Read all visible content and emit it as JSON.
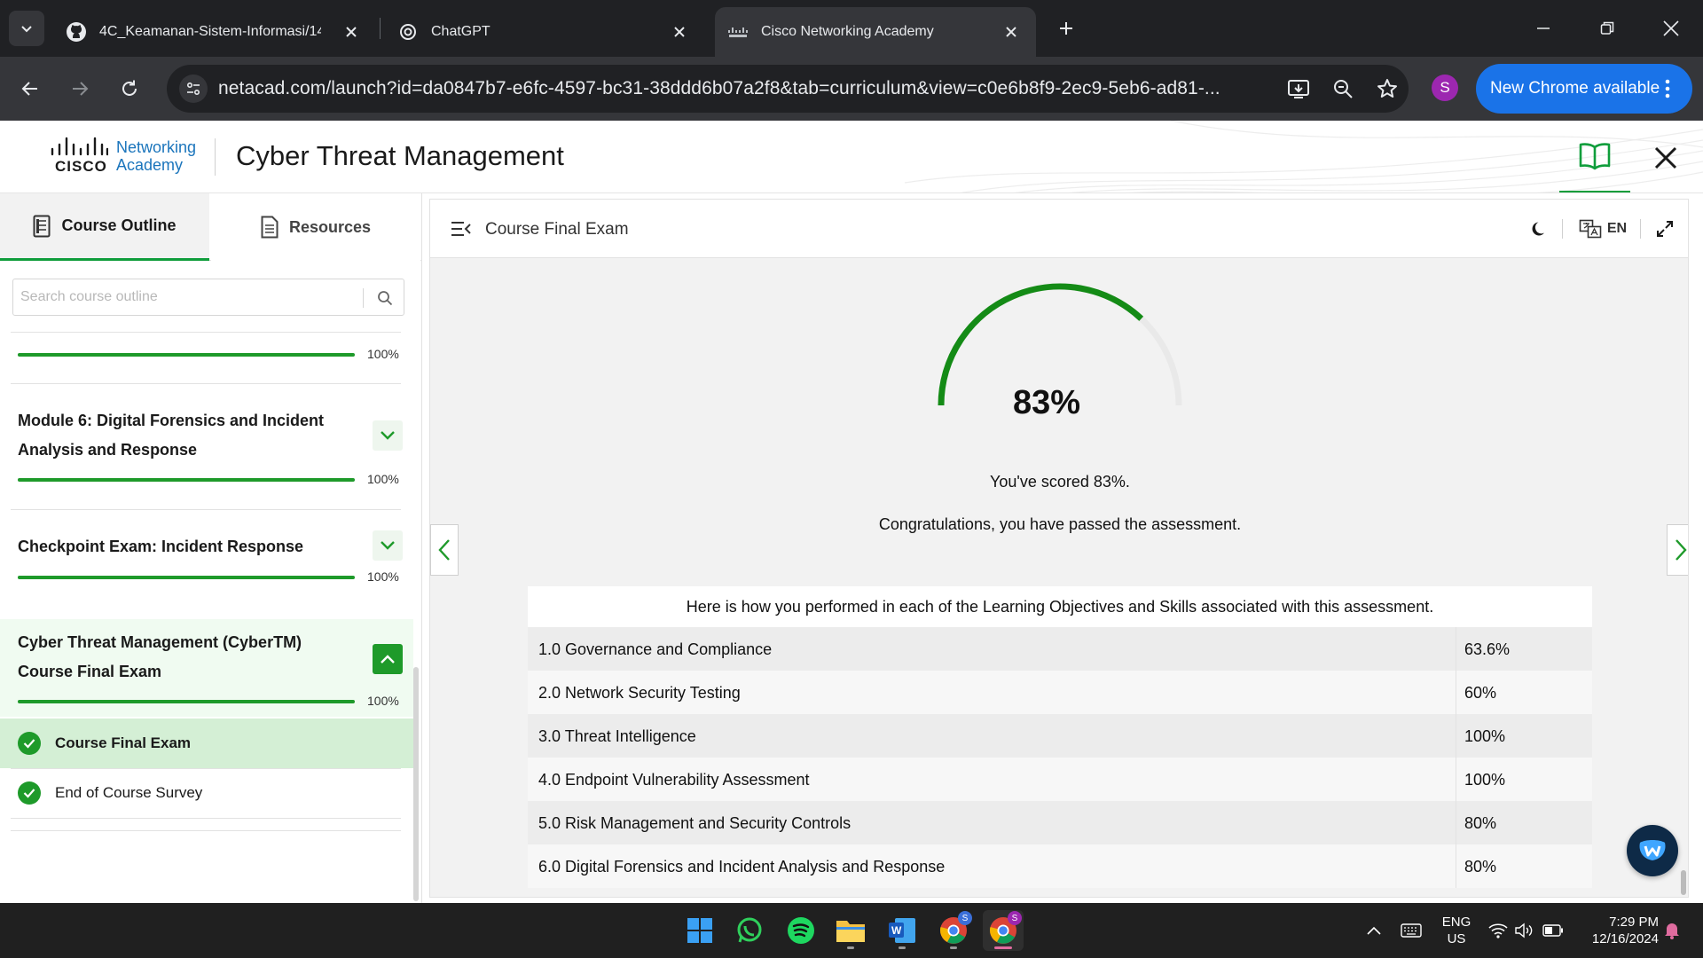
{
  "browser": {
    "tabs": [
      {
        "title": "4C_Keamanan-Sistem-Informasi/14_S...",
        "icon": "github-icon"
      },
      {
        "title": "ChatGPT",
        "icon": "openai-icon"
      },
      {
        "title": "Cisco Networking Academy",
        "icon": "cisco-icon"
      }
    ],
    "url": "netacad.com/launch?id=da0847b7-e6fc-4597-bc31-38ddd6b07a2f8&tab=curriculum&view=c0e6b8f9-2ec9-5eb6-ad81-...",
    "profile_initial": "S",
    "update_label": "New Chrome available"
  },
  "header": {
    "logo_word": "CISCO",
    "logo_line1": "Networking",
    "logo_line2": "Academy",
    "course_title": "Cyber Threat Management"
  },
  "sidebar": {
    "tabs": {
      "outline": "Course Outline",
      "resources": "Resources"
    },
    "search_placeholder": "Search course outline",
    "items": [
      {
        "title": "",
        "progress": 100,
        "progress_label": "100%"
      },
      {
        "title": "Module 6: Digital Forensics and Incident Analysis and Response",
        "progress": 100,
        "progress_label": "100%",
        "expanded": false
      },
      {
        "title": "Checkpoint Exam: Incident Response",
        "progress": 100,
        "progress_label": "100%",
        "expanded": false
      },
      {
        "title": "Cyber Threat Management (CyberTM) Course Final Exam",
        "progress": 100,
        "progress_label": "100%",
        "expanded": true
      }
    ],
    "lessons": [
      {
        "label": "Course Final Exam",
        "completed": true,
        "current": true
      },
      {
        "label": "End of Course Survey",
        "completed": true,
        "current": false
      }
    ]
  },
  "main": {
    "title": "Course Final Exam",
    "lang": "EN",
    "score": 83,
    "score_label": "83%",
    "scored_text": "You've scored 83%.",
    "congrats_text": "Congratulations, you have passed the assessment.",
    "table_intro": "Here is how you performed in each of the Learning Objectives and Skills associated with this assessment.",
    "objectives": [
      {
        "name": "1.0 Governance and Compliance",
        "score": "63.6%"
      },
      {
        "name": "2.0 Network Security Testing",
        "score": "60%"
      },
      {
        "name": "3.0 Threat Intelligence",
        "score": "100%"
      },
      {
        "name": "4.0 Endpoint Vulnerability Assessment",
        "score": "100%"
      },
      {
        "name": "5.0 Risk Management and Security Controls",
        "score": "80%"
      },
      {
        "name": "6.0 Digital Forensics and Incident Analysis and Response",
        "score": "80%"
      }
    ]
  },
  "colors": {
    "accent_green": "#1e9a2a",
    "chrome_blue": "#1a73e8",
    "cisco_blue": "#1b75bc"
  },
  "taskbar": {
    "apps": [
      "windows-start-icon",
      "whatsapp-icon",
      "spotify-icon",
      "file-explorer-icon",
      "word-icon",
      "chrome-icon",
      "chrome-icon"
    ],
    "lang_line1": "ENG",
    "lang_line2": "US",
    "time": "7:29 PM",
    "date": "12/16/2024"
  }
}
